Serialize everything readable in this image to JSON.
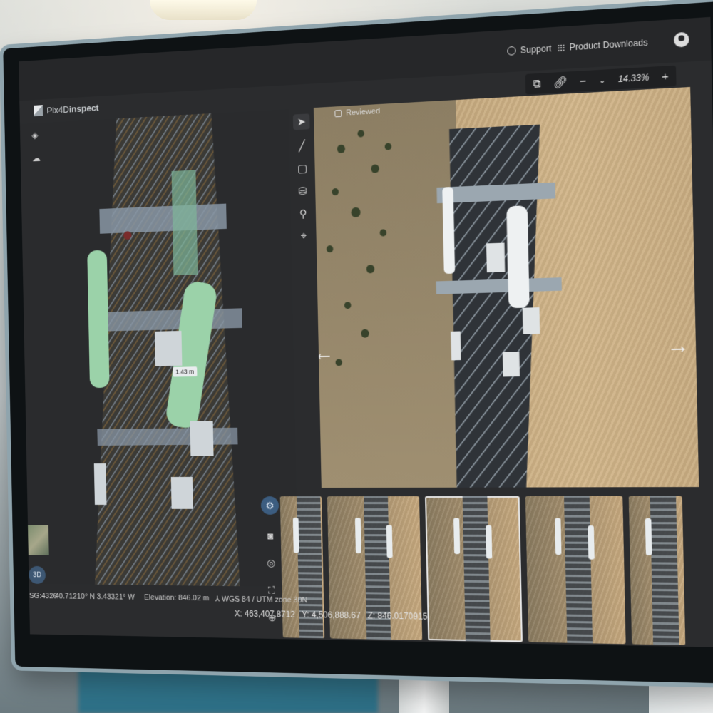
{
  "topbar": {
    "support_label": "Support",
    "downloads_label": "Product Downloads"
  },
  "app": {
    "logo_prefix": "Pix4D",
    "logo_suffix": "inspect"
  },
  "viewer": {
    "zoom_minus": "−",
    "zoom_plus": "+",
    "zoom_value": "14.33%",
    "reviewed_label": "Reviewed",
    "prev_arrow": "←",
    "next_arrow": "→"
  },
  "view3d": {
    "measure_label": "1.43 m",
    "mode_3d_label": "3D"
  },
  "status": {
    "epsg_fragment": "SG:4326",
    "lat_lon": "40.71210° N 3.43321° W",
    "elevation": "Elevation: 846.02 m",
    "crs": "WGS 84 / UTM zone 30N"
  },
  "coords": {
    "x": "X: 463,407.8712",
    "y": "Y: 4,506,888.67",
    "z": "Z: 846.0170915"
  },
  "colors": {
    "app_bg": "#2b2c2e",
    "topbar_bg": "#262729",
    "accent_blue": "#3c5d80",
    "antenna_highlight": "#9bd2a9"
  }
}
